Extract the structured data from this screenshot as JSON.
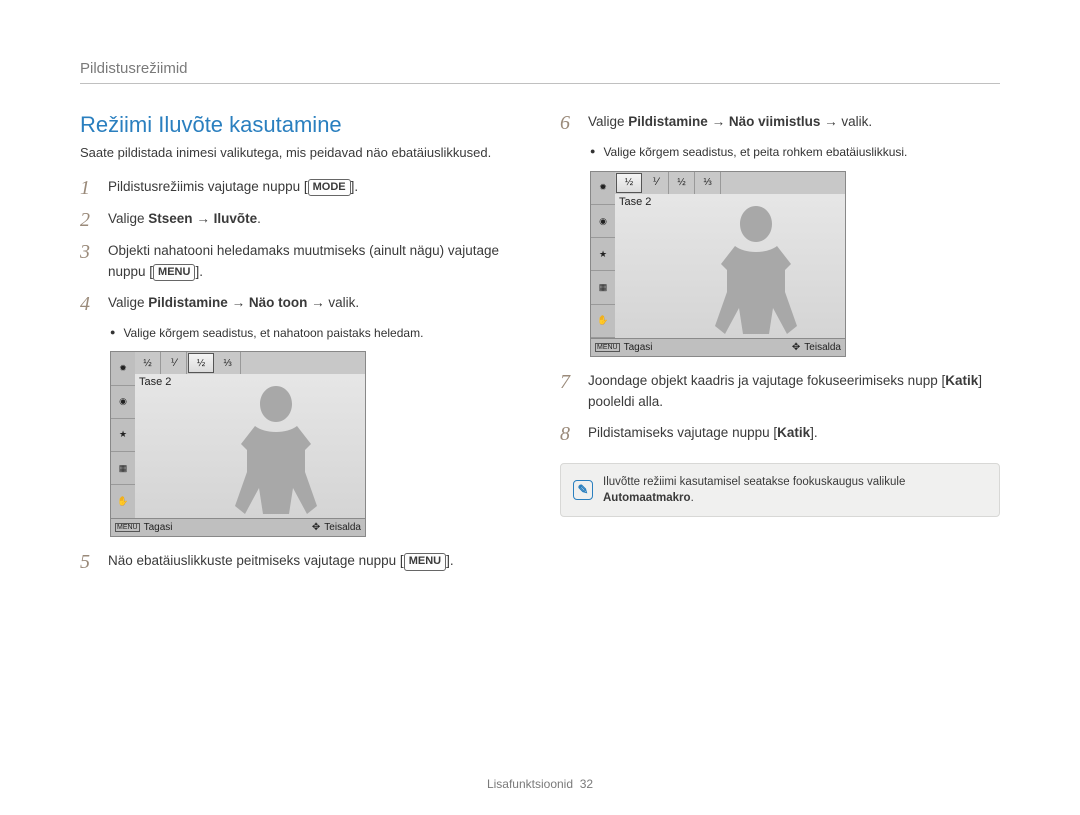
{
  "header": "Pildistusrežiimid",
  "title": "Režiimi Iluvõte kasutamine",
  "intro": "Saate pildistada inimesi valikutega, mis peidavad näo ebatäiuslikkused.",
  "steps_left": {
    "s1": {
      "num": "1",
      "pre": "Pildistusrežiimis vajutage nuppu [",
      "key": "MODE",
      "post": "]."
    },
    "s2": {
      "num": "2",
      "pre": "Valige ",
      "b1": "Stseen",
      "arrow": " → ",
      "b2": "Iluvõte",
      "post": "."
    },
    "s3": {
      "num": "3",
      "line1": "Objekti nahatooni heledamaks muutmiseks (ainult nägu) vajutage nuppu [",
      "key": "MENU",
      "line2": "]."
    },
    "s4": {
      "num": "4",
      "pre": "Valige ",
      "b1": "Pildistamine",
      "arrow1": " → ",
      "b2": "Näo toon",
      "arrow2": " → valik."
    },
    "s4_bullet": "Valige kõrgem seadistus, et nahatoon paistaks heledam.",
    "s5": {
      "num": "5",
      "pre": "Näo ebatäiuslikkuste peitmiseks vajutage nuppu [",
      "key": "MENU",
      "post": "]."
    }
  },
  "steps_right": {
    "s6": {
      "num": "6",
      "pre": "Valige ",
      "b1": "Pildistamine",
      "arrow1": " → ",
      "b2": "Näo viimistlus",
      "arrow2": " → valik."
    },
    "s6_bullet": "Valige kõrgem seadistus, et peita rohkem ebatäiuslikkusi.",
    "s7": {
      "num": "7",
      "line1": "Joondage objekt kaadris ja vajutage fokuseerimiseks nupp [",
      "b": "Katik",
      "line2": "] pooleldi alla."
    },
    "s8": {
      "num": "8",
      "pre": "Pildistamiseks vajutage nuppu [",
      "b": "Katik",
      "post": "]."
    }
  },
  "lcd": {
    "tase": "Tase 2",
    "menu_glyph": "MENU",
    "back_label": "Tagasi",
    "move_label": "Teisalda",
    "left_icons": [
      "✹",
      "◉",
      "★",
      "▦",
      "✋"
    ],
    "top_icons_a": [
      "½",
      "⅟",
      "½",
      "⅓"
    ],
    "top_icons_b": [
      "⅟",
      "½",
      "⅓"
    ],
    "top_sel_a": "½"
  },
  "note": {
    "text_pre": "Iluvõtte režiimi kasutamisel seatakse fookuskaugus valikule ",
    "b": "Automaatmakro",
    "text_post": "."
  },
  "footer": {
    "label": "Lisafunktsioonid",
    "page": "32"
  }
}
